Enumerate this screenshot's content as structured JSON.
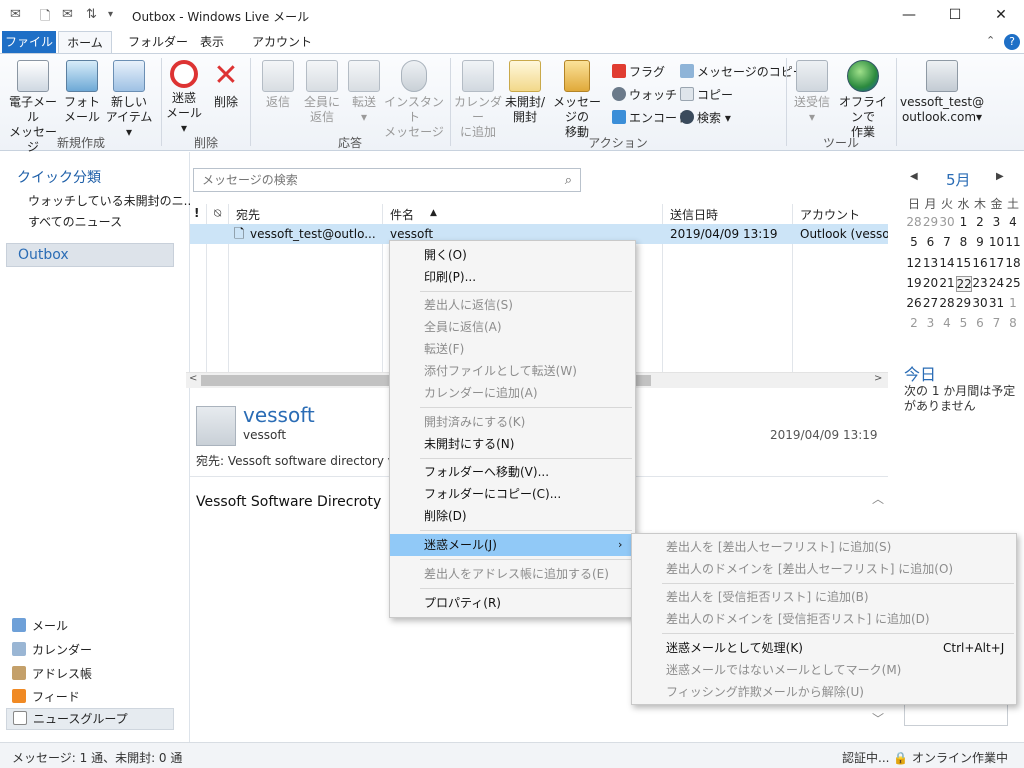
{
  "window": {
    "title": "Outbox - Windows Live メール",
    "minimize": "—",
    "maximize": "☐",
    "close": "✕"
  },
  "tabs": [
    "ファイル",
    "ホーム",
    "フォルダー",
    "表示",
    "アカウント"
  ],
  "ribbon": {
    "groups": [
      "新規作成",
      "削除",
      "応答",
      "アクション",
      "ツール"
    ],
    "new_email": [
      "電子メール",
      "メッセージ"
    ],
    "photo_mail": [
      "フォト",
      "メール"
    ],
    "new_item": [
      "新しい",
      "アイテム▾"
    ],
    "junk": [
      "迷惑",
      "メール▾"
    ],
    "delete": [
      "削除",
      ""
    ],
    "reply": [
      "返信",
      ""
    ],
    "reply_all": [
      "全員に",
      "返信"
    ],
    "forward": [
      "転送",
      "▾"
    ],
    "instant_msg": [
      "インスタント",
      "メッセージ"
    ],
    "add_calendar": [
      "カレンダー",
      "に追加"
    ],
    "unread_read": [
      "未開封/",
      "開封"
    ],
    "move_msg": [
      "メッセージの",
      "移動"
    ],
    "flag": "フラグ",
    "watch": "ウォッチ",
    "encode": "エンコード",
    "copy_msg": "メッセージのコピー",
    "copy": "コピー",
    "find": "検索 ▾",
    "send_recv": [
      "送受信",
      "▾"
    ],
    "offline": [
      "オフラインで",
      "作業"
    ],
    "account": [
      "vessoft_test@",
      "outlook.com▾"
    ]
  },
  "nav": {
    "quick_title": "クイック分類",
    "quick_items": [
      "ウォッチしている未開封のニ...",
      "すべてのニュース"
    ],
    "outbox": "Outbox",
    "bottom": [
      "メール",
      "カレンダー",
      "アドレス帳",
      "フィード",
      "ニュースグループ"
    ]
  },
  "search": {
    "placeholder": "メッセージの検索"
  },
  "list": {
    "cols": [
      "!",
      "宛先",
      "件名",
      "送信日時",
      "アカウント"
    ],
    "row": {
      "to": "vessoft_test@outlo...",
      "subject": "vessoft",
      "date": "2019/04/09 13:19",
      "account": "Outlook (vesso"
    }
  },
  "preview": {
    "name": "vessoft",
    "sub": "vessoft",
    "date": "2019/04/09 13:19",
    "to": "宛先: Vessoft software directory v",
    "body": "Vessoft Software Direcroty"
  },
  "calendar": {
    "month": "5月",
    "weekdays": [
      "日",
      "月",
      "火",
      "水",
      "木",
      "金",
      "土"
    ],
    "weeks": [
      [
        "28",
        "29",
        "30",
        "1",
        "2",
        "3",
        "4"
      ],
      [
        "5",
        "6",
        "7",
        "8",
        "9",
        "10",
        "11"
      ],
      [
        "12",
        "13",
        "14",
        "15",
        "16",
        "17",
        "18"
      ],
      [
        "19",
        "20",
        "21",
        "22",
        "23",
        "24",
        "25"
      ],
      [
        "26",
        "27",
        "28",
        "29",
        "30",
        "31",
        "1"
      ],
      [
        "2",
        "3",
        "4",
        "5",
        "6",
        "7",
        "8"
      ]
    ],
    "today_label": "今日",
    "today_text": "次の 1 か月間は予定がありません"
  },
  "status": {
    "left": "メッセージ: 1 通、未開封: 0 通",
    "right": "認証中... 🔒 オンライン作業中"
  },
  "context_menu": {
    "open": "開く(O)",
    "print": "印刷(P)...",
    "reply_sender": "差出人に返信(S)",
    "reply_all": "全員に返信(A)",
    "forward": "転送(F)",
    "forward_attach": "添付ファイルとして転送(W)",
    "add_calendar": "カレンダーに追加(A)",
    "mark_read": "開封済みにする(K)",
    "mark_unread": "未開封にする(N)",
    "move_folder": "フォルダーへ移動(V)...",
    "copy_folder": "フォルダーにコピー(C)...",
    "delete": "削除(D)",
    "junk": "迷惑メール(J)",
    "add_sender": "差出人をアドレス帳に追加する(E)",
    "properties": "プロパティ(R)"
  },
  "submenu": {
    "safe_sender": "差出人を [差出人セーフリスト] に追加(S)",
    "safe_domain": "差出人のドメインを [差出人セーフリスト] に追加(O)",
    "block_sender": "差出人を [受信拒否リスト] に追加(B)",
    "block_domain": "差出人のドメインを [受信拒否リスト] に追加(D)",
    "mark_junk": "迷惑メールとして処理(K)",
    "mark_junk_shortcut": "Ctrl+Alt+J",
    "not_junk": "迷惑メールではないメールとしてマーク(M)",
    "phishing": "フィッシング詐欺メールから解除(U)"
  }
}
